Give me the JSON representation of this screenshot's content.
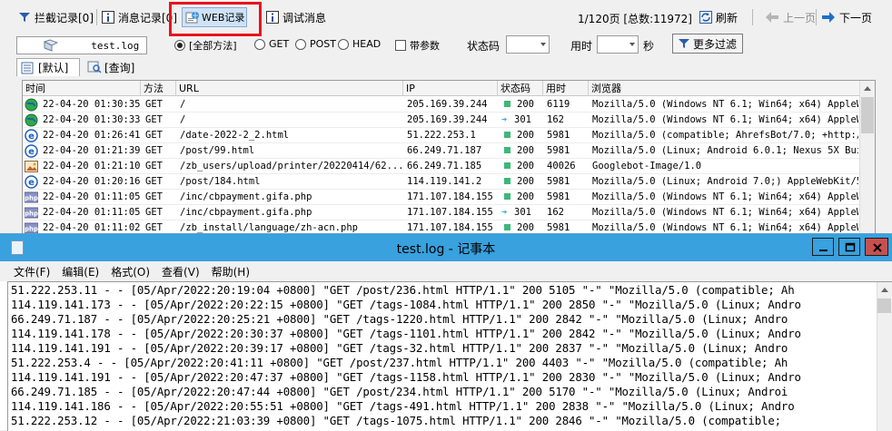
{
  "toolbar": {
    "intercept_label": "拦截记录[0]",
    "message_label": "消息记录[0]",
    "web_label": "WEB记录",
    "debug_label": "调试消息",
    "page_info": "1/120页 [总数:11972]",
    "refresh_label": "刷新",
    "prev_label": "上一页",
    "next_label": "下一页"
  },
  "filter": {
    "file_value": "test.log",
    "radios": [
      "[全部方法]",
      "GET",
      "POST",
      "HEAD"
    ],
    "selected_radio": "[全部方法]",
    "with_params_label": "带参数",
    "status_label": "状态码",
    "time_label": "用时",
    "seconds_label": "秒",
    "more_filter_label": "更多过滤"
  },
  "tabs": [
    {
      "label": "[默认]"
    },
    {
      "label": "[查询]"
    }
  ],
  "table": {
    "columns": [
      "时间",
      "方法",
      "URL",
      "IP",
      "状态码",
      "用时",
      "浏览器"
    ],
    "rows": [
      {
        "icon": "globe-icon",
        "time": "22-04-20 01:30:35",
        "method": "GET",
        "url": "/",
        "ip": "205.169.39.244",
        "status": "200",
        "status_kind": "ok",
        "duration": "6119",
        "ua": "Mozilla/5.0 (Windows NT 6.1; Win64; x64) AppleWeb"
      },
      {
        "icon": "globe-icon",
        "time": "22-04-20 01:30:33",
        "method": "GET",
        "url": "/",
        "ip": "205.169.39.244",
        "status": "301",
        "status_kind": "redirect",
        "duration": "162",
        "ua": "Mozilla/5.0 (Windows NT 6.1; Win64; x64) AppleWeb"
      },
      {
        "icon": "ie-icon",
        "time": "22-04-20 01:26:41",
        "method": "GET",
        "url": "/date-2022-2_2.html",
        "ip": "51.222.253.1",
        "status": "200",
        "status_kind": "ok",
        "duration": "5981",
        "ua": "Mozilla/5.0 (compatible; AhrefsBot/7.0; +http://a"
      },
      {
        "icon": "ie-icon",
        "time": "22-04-20 01:21:39",
        "method": "GET",
        "url": "/post/99.html",
        "ip": "66.249.71.187",
        "status": "200",
        "status_kind": "ok",
        "duration": "5981",
        "ua": "Mozilla/5.0 (Linux; Android 6.0.1; Nexus 5X Build"
      },
      {
        "icon": "image-icon",
        "time": "22-04-20 01:21:10",
        "method": "GET",
        "url": "/zb_users/upload/printer/20220414/62...",
        "ip": "66.249.71.185",
        "status": "200",
        "status_kind": "ok",
        "duration": "40026",
        "ua": "Googlebot-Image/1.0"
      },
      {
        "icon": "ie-icon",
        "time": "22-04-20 01:20:16",
        "method": "GET",
        "url": "/post/184.html",
        "ip": "114.119.141.2",
        "status": "200",
        "status_kind": "ok",
        "duration": "5981",
        "ua": "Mozilla/5.0 (Linux; Android 7.0;) AppleWebKit/537"
      },
      {
        "icon": "php-icon",
        "time": "22-04-20 01:11:05",
        "method": "GET",
        "url": "/inc/cbpayment.gifa.php",
        "ip": "171.107.184.155",
        "status": "200",
        "status_kind": "ok",
        "duration": "5981",
        "ua": "Mozilla/5.0 (Windows NT 6.1; Win64; x64) AppleWeb"
      },
      {
        "icon": "php-icon",
        "time": "22-04-20 01:11:05",
        "method": "GET",
        "url": "/inc/cbpayment.gifa.php",
        "ip": "171.107.184.155",
        "status": "301",
        "status_kind": "redirect",
        "duration": "162",
        "ua": "Mozilla/5.0 (Windows NT 6.1; Win64; x64) AppleWeb"
      },
      {
        "icon": "php-icon",
        "time": "22-04-20 01:11:02",
        "method": "GET",
        "url": "/zb_install/language/zh-acn.php",
        "ip": "171.107.184.155",
        "status": "200",
        "status_kind": "ok",
        "duration": "5981",
        "ua": "Mozilla/5.0 (Windows NT 6.1; Win64; x64) AppleWeb"
      }
    ]
  },
  "notepad": {
    "title": "test.log - 记事本",
    "menu": [
      "文件(F)",
      "编辑(E)",
      "格式(O)",
      "查看(V)",
      "帮助(H)"
    ],
    "lines": [
      "51.222.253.11 - - [05/Apr/2022:20:19:04 +0800] \"GET /post/236.html HTTP/1.1\" 200 5105 \"-\" \"Mozilla/5.0 (compatible; Ah",
      "114.119.141.173 - - [05/Apr/2022:20:22:15 +0800] \"GET /tags-1084.html HTTP/1.1\" 200 2850 \"-\" \"Mozilla/5.0 (Linux; Andro",
      "66.249.71.187 - - [05/Apr/2022:20:25:21 +0800] \"GET /tags-1220.html HTTP/1.1\" 200 2842 \"-\" \"Mozilla/5.0 (Linux; Andro",
      "114.119.141.178 - - [05/Apr/2022:20:30:37 +0800] \"GET /tags-1101.html HTTP/1.1\" 200 2842 \"-\" \"Mozilla/5.0 (Linux; Andro",
      "114.119.141.191 - - [05/Apr/2022:20:39:17 +0800] \"GET /tags-32.html HTTP/1.1\" 200 2837 \"-\" \"Mozilla/5.0 (Linux; Andro",
      "51.222.253.4 - - [05/Apr/2022:20:41:11 +0800] \"GET /post/237.html HTTP/1.1\" 200 4403 \"-\" \"Mozilla/5.0 (compatible; Ah",
      "114.119.141.191 - - [05/Apr/2022:20:47:37 +0800] \"GET /tags-1158.html HTTP/1.1\" 200 2830 \"-\" \"Mozilla/5.0 (Linux; Andro",
      "66.249.71.185 - - [05/Apr/2022:20:47:44 +0800] \"GET /post/234.html HTTP/1.1\" 200 5170 \"-\" \"Mozilla/5.0 (Linux; Androi",
      "114.119.141.186 - - [05/Apr/2022:20:55:51 +0800] \"GET /tags-491.html HTTP/1.1\" 200 2838 \"-\" \"Mozilla/5.0 (Linux; Andro",
      "51.222.253.12 - - [05/Apr/2022:21:03:39 +0800] \"GET /tags-1075.html HTTP/1.1\" 200 2846 \"-\" \"Mozilla/5.0 (compatible; "
    ]
  },
  "colors": {
    "highlight": "#e8141c",
    "titlebar": "#38a1de",
    "status_ok": "#3cb878",
    "status_redirect": "#2a9fd8"
  }
}
